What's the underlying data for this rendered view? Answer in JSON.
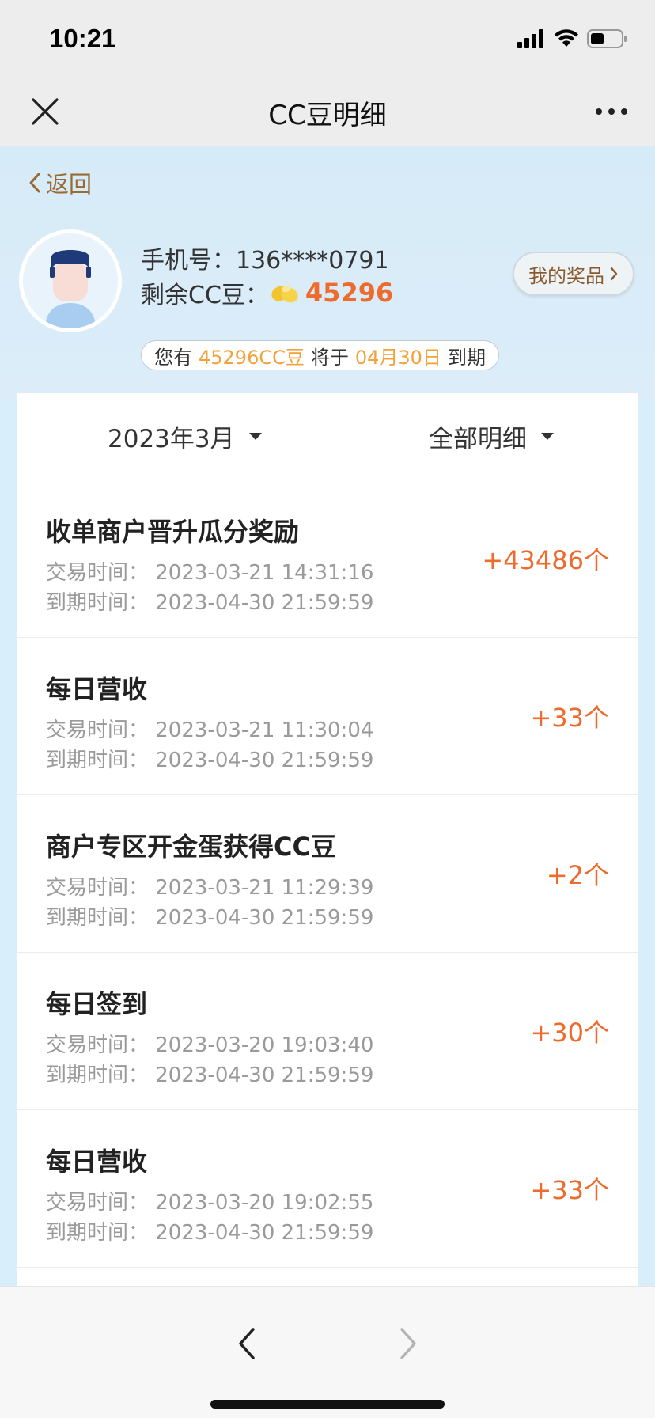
{
  "status_bar": {
    "time": "10:21"
  },
  "nav": {
    "title": "CC豆明细"
  },
  "header": {
    "back_label": "返回",
    "phone_label": "手机号：",
    "phone_value": "136****0791",
    "beans_label": "剩余CC豆：",
    "beans_value": "45296",
    "prize_button": "我的奖品",
    "expire_notice": {
      "prefix": "您有",
      "amount": "45296CC豆",
      "middle": "将于",
      "date": "04月30日",
      "suffix": "到期"
    }
  },
  "filters": {
    "month": "2023年3月",
    "type": "全部明细"
  },
  "records": [
    {
      "title": "收单商户晋升瓜分奖励",
      "trade_time": "交易时间：  2023-03-21 14:31:16",
      "expire_time": "到期时间：  2023-04-30 21:59:59",
      "amount": "+43486个"
    },
    {
      "title": "每日营收",
      "trade_time": "交易时间：  2023-03-21 11:30:04",
      "expire_time": "到期时间：  2023-04-30 21:59:59",
      "amount": "+33个"
    },
    {
      "title": "商户专区开金蛋获得CC豆",
      "trade_time": "交易时间：  2023-03-21 11:29:39",
      "expire_time": "到期时间：  2023-04-30 21:59:59",
      "amount": "+2个"
    },
    {
      "title": "每日签到",
      "trade_time": "交易时间：  2023-03-20 19:03:40",
      "expire_time": "到期时间：  2023-04-30 21:59:59",
      "amount": "+30个"
    },
    {
      "title": "每日营收",
      "trade_time": "交易时间：  2023-03-20 19:02:55",
      "expire_time": "到期时间：  2023-04-30 21:59:59",
      "amount": "+33个"
    }
  ],
  "colors": {
    "accent_orange": "#ee6b2e",
    "highlight_yellow": "#f2a23a",
    "back_brown": "#9a6a33",
    "header_bg": "#d9eefb"
  },
  "icons": [
    "close-icon",
    "more-icon",
    "chevron-left-icon",
    "bean-icon",
    "chevron-right-icon",
    "caret-down-icon",
    "signal-icon",
    "wifi-icon",
    "battery-icon"
  ]
}
